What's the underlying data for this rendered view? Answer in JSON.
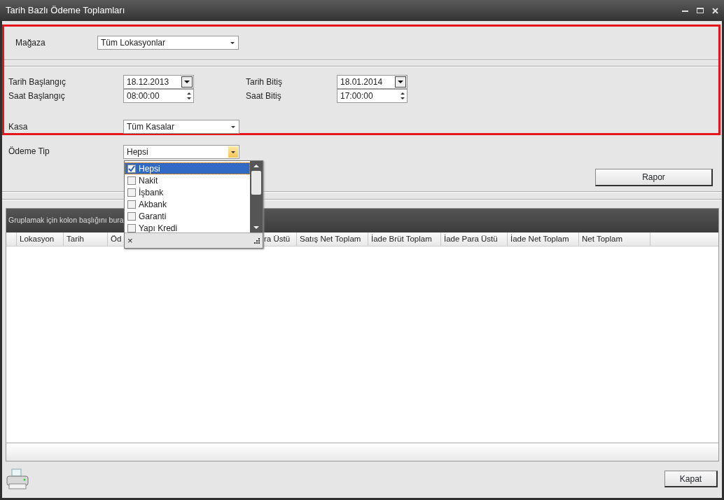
{
  "window": {
    "title": "Tarih Bazlı Ödeme Toplamları"
  },
  "filters": {
    "store": {
      "label": "Mağaza",
      "value": "Tüm Lokasyonlar"
    },
    "start_date": {
      "label": "Tarih Başlangıç",
      "value": "18.12.2013"
    },
    "end_date": {
      "label": "Tarih Bitiş",
      "value": "18.01.2014"
    },
    "start_time": {
      "label": "Saat Başlangıç",
      "value": "08:00:00"
    },
    "end_time": {
      "label": "Saat Bitiş",
      "value": "17:00:00"
    },
    "register": {
      "label": "Kasa",
      "value": "Tüm Kasalar"
    }
  },
  "payment_type": {
    "label": "Ödeme Tip",
    "value": "Hepsi",
    "expanded": true,
    "options": [
      {
        "label": "Hepsi",
        "checked": true,
        "selected": true
      },
      {
        "label": "Nakit",
        "checked": false,
        "selected": false
      },
      {
        "label": "İşbank",
        "checked": false,
        "selected": false
      },
      {
        "label": "Akbank",
        "checked": false,
        "selected": false
      },
      {
        "label": "Garanti",
        "checked": false,
        "selected": false
      },
      {
        "label": "Yapı Kredi",
        "checked": false,
        "selected": false
      }
    ],
    "close": "×"
  },
  "report_button": "Rapor",
  "grid": {
    "group_hint": "Gruplamak için kolon başlığını bura",
    "columns": [
      "Lokasyon",
      "Tarih",
      "Öd",
      "ra Üstü",
      "Satış Net Toplam",
      "İade Brüt Toplam",
      "İade Para Üstü",
      "İade Net Toplam",
      "Net Toplam"
    ]
  },
  "close_button": "Kapat"
}
